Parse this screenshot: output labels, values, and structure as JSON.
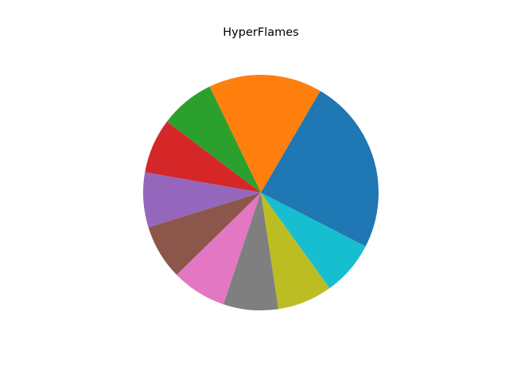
{
  "chart_data": {
    "type": "pie",
    "title": "HyperFlames",
    "start_angle_deg": 0,
    "direction": "counterclockwise",
    "slices": [
      {
        "value": 0.165,
        "color": "#1f77b4"
      },
      {
        "value": 0.155,
        "color": "#ff7f0e"
      },
      {
        "value": 0.075,
        "color": "#2ca02c"
      },
      {
        "value": 0.075,
        "color": "#d62728"
      },
      {
        "value": 0.075,
        "color": "#9467bd"
      },
      {
        "value": 0.075,
        "color": "#8c564b"
      },
      {
        "value": 0.075,
        "color": "#e377c2"
      },
      {
        "value": 0.075,
        "color": "#7f7f7f"
      },
      {
        "value": 0.075,
        "color": "#bcbd22"
      },
      {
        "value": 0.075,
        "color": "#17becf"
      },
      {
        "value": 0.075,
        "color": "#1f77b4"
      }
    ]
  }
}
